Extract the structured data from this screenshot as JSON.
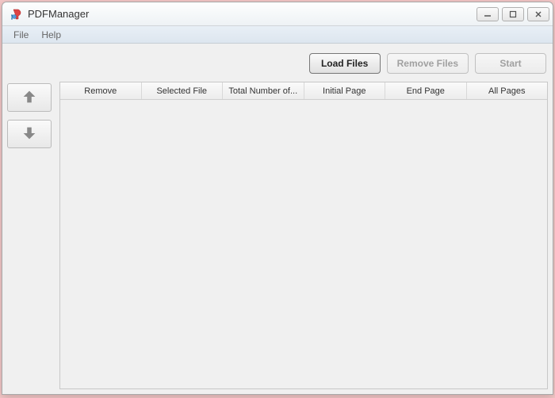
{
  "window": {
    "title": "PDFManager"
  },
  "menu": {
    "file": "File",
    "help": "Help"
  },
  "toolbar": {
    "load_files": "Load Files",
    "remove_files": "Remove Files",
    "start": "Start"
  },
  "table": {
    "columns": {
      "remove": "Remove",
      "selected_file": "Selected File",
      "total_pages": "Total Number of...",
      "initial_page": "Initial Page",
      "end_page": "End Page",
      "all_pages": "All Pages"
    },
    "rows": []
  }
}
